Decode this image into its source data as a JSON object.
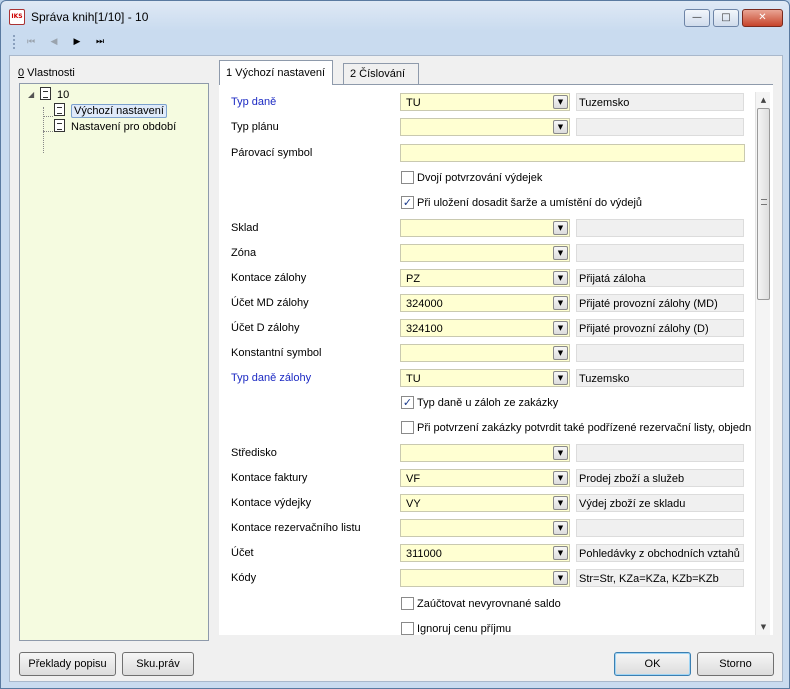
{
  "window": {
    "title": "Správa knih[1/10] - 10",
    "icon_text": "IKS",
    "minimize_icon": "minimize-icon",
    "maximize_icon": "maximize-icon",
    "close_icon": "close-icon"
  },
  "toolbar": {
    "first": "⏮",
    "prev": "◀",
    "next": "▶",
    "last": "⏭"
  },
  "left_panel": {
    "label_key": "0",
    "label_rest": " Vlastnosti",
    "tree": {
      "root": "10",
      "children": [
        "Výchozí nastavení",
        "Nastavení pro období"
      ]
    }
  },
  "tabs": [
    "1 Výchozí nastavení",
    "2 Číslování"
  ],
  "form": {
    "typ_dane": {
      "label": "Typ daně",
      "value": "TU",
      "desc": "Tuzemsko"
    },
    "typ_planu": {
      "label": "Typ plánu",
      "value": "",
      "desc": ""
    },
    "parovaci_symbol": {
      "label": "Párovací symbol",
      "value": ""
    },
    "dvoji_potvrzovani": {
      "label": "Dvojí potvrzování výdejek",
      "checked": false
    },
    "pri_ulozeni": {
      "label": "Při uložení dosadit šarže a umístění do výdejů",
      "checked": true
    },
    "sklad": {
      "label": "Sklad",
      "value": "",
      "desc": ""
    },
    "zona": {
      "label": "Zóna",
      "value": "",
      "desc": ""
    },
    "kontace_zalohy": {
      "label": "Kontace zálohy",
      "value": "PZ",
      "desc": "Přijatá záloha"
    },
    "ucet_md_zalohy": {
      "label": "Účet MD zálohy",
      "value": "324000",
      "desc": "Přijaté provozní zálohy (MD)"
    },
    "ucet_d_zalohy": {
      "label": "Účet D zálohy",
      "value": "324100",
      "desc": "Přijaté provozní zálohy (D)"
    },
    "konstantni_symbol": {
      "label": "Konstantní symbol",
      "value": "",
      "desc": ""
    },
    "typ_dane_zalohy": {
      "label": "Typ daně zálohy",
      "value": "TU",
      "desc": "Tuzemsko"
    },
    "typ_dane_u_zaloh": {
      "label": "Typ daně u záloh ze zakázky",
      "checked": true
    },
    "pri_potvrzeni": {
      "label": "Při potvrzení zakázky potvrdit také podřízené rezervační listy, objedn",
      "checked": false
    },
    "stredisko": {
      "label": "Středisko",
      "value": "",
      "desc": ""
    },
    "kontace_faktury": {
      "label": "Kontace faktury",
      "value": "VF",
      "desc": "Prodej zboží a služeb"
    },
    "kontace_vydejky": {
      "label": "Kontace výdejky",
      "value": "VY",
      "desc": "Výdej zboží ze skladu"
    },
    "kontace_rezervacniho": {
      "label": "Kontace rezervačního listu",
      "value": "",
      "desc": ""
    },
    "ucet": {
      "label": "Účet",
      "value": "311000",
      "desc": "Pohledávky z obchodních vztahů"
    },
    "kody": {
      "label": "Kódy",
      "value": "",
      "desc": "Str=Str, KZa=KZa, KZb=KZb"
    },
    "zauctovat": {
      "label": "Zaúčtovat nevyrovnané saldo",
      "checked": false
    },
    "ignoruj": {
      "label": "Ignoruj cenu příjmu",
      "checked": false
    }
  },
  "footer": {
    "preklady": "Překlady popisu",
    "sku_prav": "Sku.práv",
    "ok": "OK",
    "storno": "Storno"
  },
  "check_mark": "✓",
  "dropdown_glyph": "▼",
  "colors": {
    "required_label": "#1c2ac3",
    "field_bg": "#ffffd2",
    "tree_bg": "#f5fbe0"
  }
}
